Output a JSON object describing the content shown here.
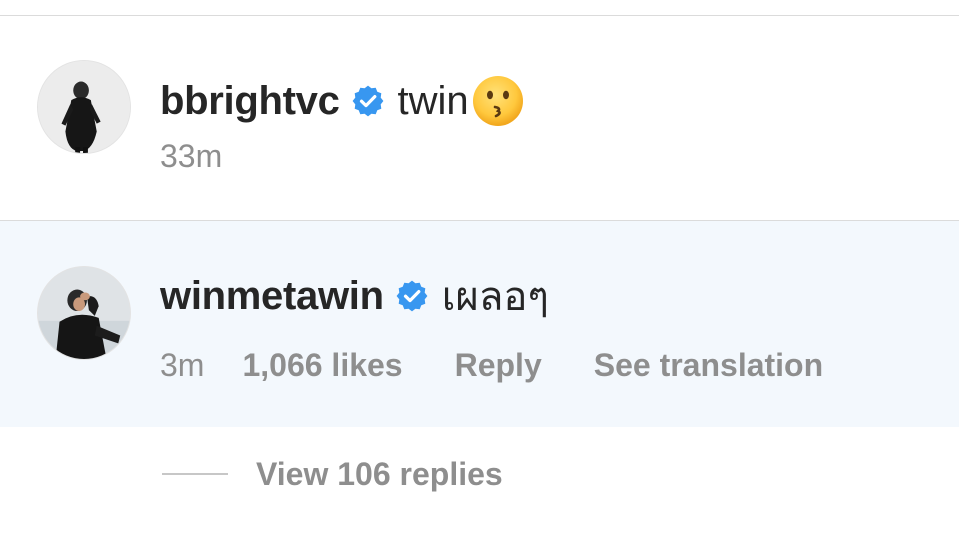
{
  "comments": [
    {
      "username": "bbrightvc",
      "verified": true,
      "text": "twin",
      "emoji": "kissing-face-emoji",
      "time": "33m",
      "actions": []
    },
    {
      "username": "winmetawin",
      "verified": true,
      "text": "เผลอๆ",
      "time": "3m",
      "likes": "1,066 likes",
      "reply": "Reply",
      "translate": "See translation",
      "highlighted": true
    }
  ],
  "view_replies": "View 106 replies",
  "colors": {
    "text_primary": "#262626",
    "text_secondary": "#8e8e8e",
    "verified_blue": "#3897f0",
    "highlight_bg": "#f3f8fd",
    "divider": "#dbdbdb"
  },
  "icons": {
    "verified": "verified-badge-icon",
    "emoji": "kissing-face-emoji"
  }
}
